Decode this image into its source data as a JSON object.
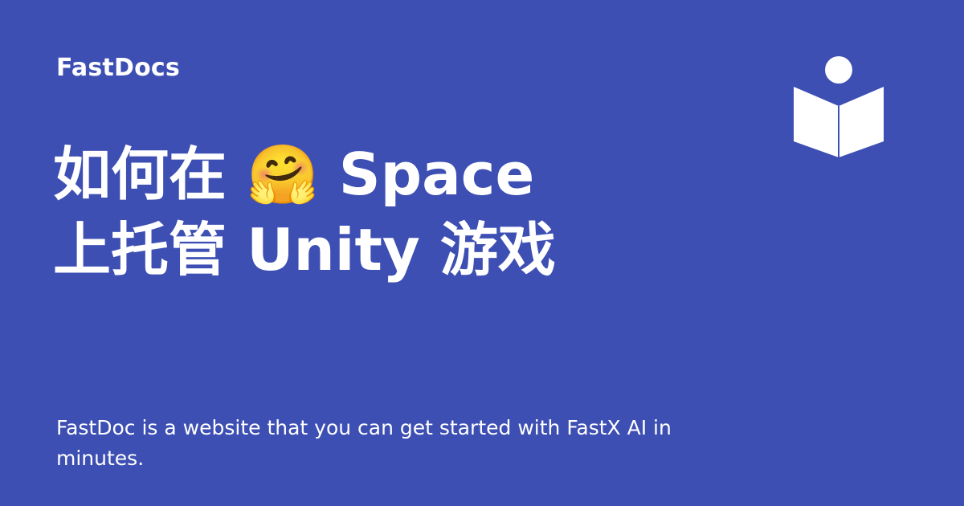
{
  "brand": {
    "name": "FastDocs"
  },
  "title": {
    "line1": "如何在 🤗 Space",
    "line2": "上托管 Unity 游戏"
  },
  "description": {
    "text": "FastDoc is a website that you can get started with FastX AI in minutes."
  },
  "icon": {
    "name": "book-reader-icon",
    "color": "#ffffff"
  },
  "colors": {
    "background": "#3d4fb3",
    "text": "#ffffff"
  }
}
